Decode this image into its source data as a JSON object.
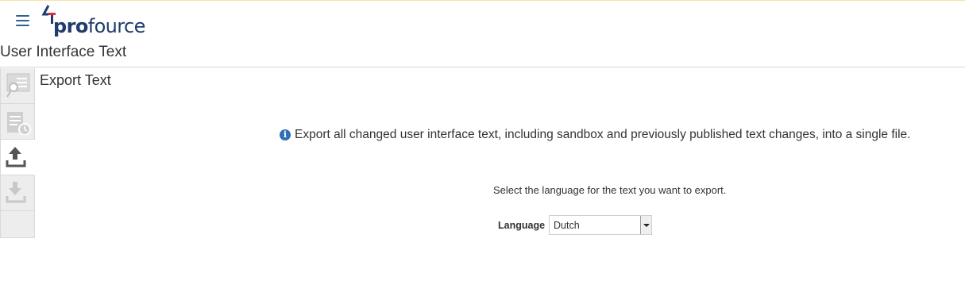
{
  "header": {
    "logo_text_bold": "pro",
    "logo_text_regular": "fource",
    "page_title": "User Interface Text",
    "colors": {
      "brand": "#1f3c6d",
      "accent": "#2f5f97",
      "logo_red": "#d9343c"
    }
  },
  "sidebar": {
    "items": [
      {
        "icon": "search-document-icon",
        "active": false
      },
      {
        "icon": "history-document-icon",
        "active": false
      },
      {
        "icon": "upload-export-icon",
        "active": true
      },
      {
        "icon": "download-import-icon",
        "active": false
      }
    ]
  },
  "main": {
    "section_title": "Export Text",
    "info_text": "Export all changed user interface text, including sandbox and previously published text changes, into a single file.",
    "instruction": "Select the language for the text you want to export.",
    "language_label": "Language",
    "language_value": "Dutch"
  }
}
